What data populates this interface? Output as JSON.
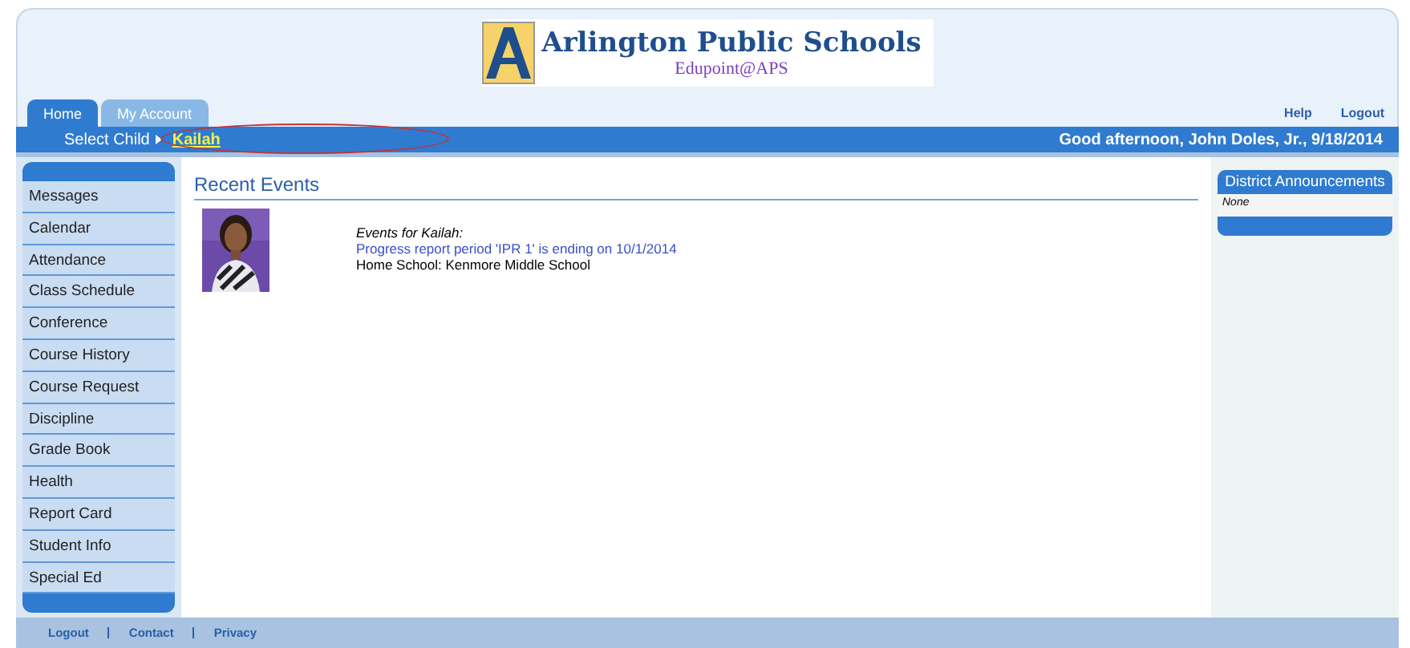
{
  "logo": {
    "title": "Arlington Public Schools",
    "subtitle": "Edupoint@APS"
  },
  "top_links": [
    "Help",
    "Logout"
  ],
  "tabs": [
    {
      "label": "Home",
      "selected": true
    },
    {
      "label": "My Account",
      "selected": false
    }
  ],
  "child_bar": {
    "label": "Select Child",
    "child": "Kailah",
    "greeting": "Good afternoon, John Doles, Jr., 9/18/2014"
  },
  "sidebar": {
    "items": [
      {
        "label": "Messages"
      },
      {
        "label": "Calendar"
      },
      {
        "label": "Attendance"
      },
      {
        "label": "Class Schedule"
      },
      {
        "label": "Conference"
      },
      {
        "label": "Course History"
      },
      {
        "label": "Course Request"
      },
      {
        "label": "Discipline"
      },
      {
        "label": "Grade Book"
      },
      {
        "label": "Health"
      },
      {
        "label": "Report Card"
      },
      {
        "label": "Student Info"
      },
      {
        "label": "Special Ed"
      }
    ]
  },
  "recent_events": {
    "title": "Recent Events",
    "heading": "Events for Kailah:",
    "event": "Progress report period 'IPR 1' is ending on 10/1/2014",
    "home_school": "Home School: Kenmore Middle School"
  },
  "announcements": {
    "title": "District Announcements",
    "body": "None"
  },
  "footer_links": [
    "Logout",
    "Contact",
    "Privacy"
  ]
}
